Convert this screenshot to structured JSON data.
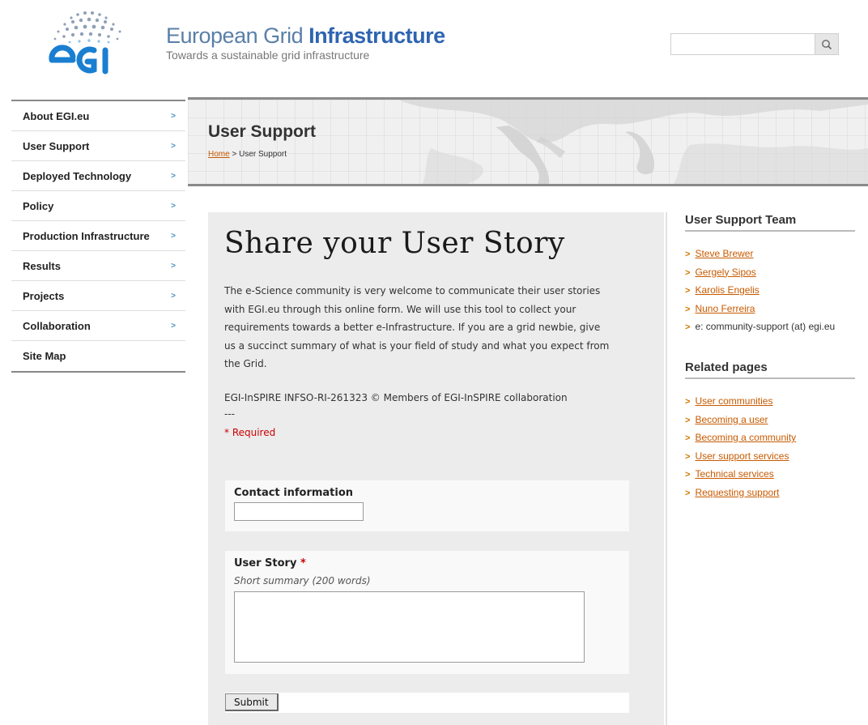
{
  "header": {
    "title_prefix": "European Grid ",
    "title_bold": "Infrastructure",
    "tagline": "Towards a sustainable grid infrastructure",
    "search": {
      "value": "",
      "placeholder": ""
    }
  },
  "nav": {
    "items": [
      {
        "label": "About EGI.eu",
        "arrow": ">"
      },
      {
        "label": "User Support",
        "arrow": ">"
      },
      {
        "label": "Deployed Technology",
        "arrow": ">"
      },
      {
        "label": "Policy",
        "arrow": ">"
      },
      {
        "label": "Production Infrastructure",
        "arrow": ">"
      },
      {
        "label": "Results",
        "arrow": ">"
      },
      {
        "label": "Projects",
        "arrow": ">"
      },
      {
        "label": "Collaboration",
        "arrow": ">"
      },
      {
        "label": "Site Map",
        "arrow": ""
      }
    ]
  },
  "banner": {
    "title": "User Support",
    "breadcrumb_home": "Home",
    "breadcrumb_sep": " > ",
    "breadcrumb_current": "User Support"
  },
  "form": {
    "heading": "Share your User Story",
    "intro": "The e-Science community is very welcome to communicate their user stories with EGI.eu through this online form. We will use this tool to collect your requirements towards a better e-Infrastructure. If you are a grid newbie, give us a succinct summary of what is your field of study and what you expect from the Grid.",
    "copyright": "EGI-InSPIRE INFSO-RI-261323 © Members of EGI-InSPIRE collaboration",
    "separator": "---",
    "required_note": "* Required",
    "contact_label": "Contact information",
    "contact_value": "",
    "story_label": "User Story",
    "story_required_mark": "*",
    "story_hint": "Short summary (200 words)",
    "story_value": "",
    "submit_label": "Submit"
  },
  "sidebar": {
    "team_heading": "User Support Team",
    "team": [
      {
        "label": "Steve Brewer",
        "link": true
      },
      {
        "label": "Gergely Sipos",
        "link": true
      },
      {
        "label": "Karolis Engelis",
        "link": true
      },
      {
        "label": "Nuno Ferreira",
        "link": true
      },
      {
        "label": "e: community-support (at) egi.eu",
        "link": false
      }
    ],
    "related_heading": "Related pages",
    "related": [
      {
        "label": "User communities"
      },
      {
        "label": "Becoming a user"
      },
      {
        "label": "Becoming a community"
      },
      {
        "label": "User support services"
      },
      {
        "label": "Technical services"
      },
      {
        "label": "Requesting support"
      }
    ]
  },
  "colors": {
    "brand_blue": "#2e64b1",
    "link_orange": "#c85a00",
    "required_red": "#cc0000",
    "nav_arrow": "#4a8fc0"
  }
}
